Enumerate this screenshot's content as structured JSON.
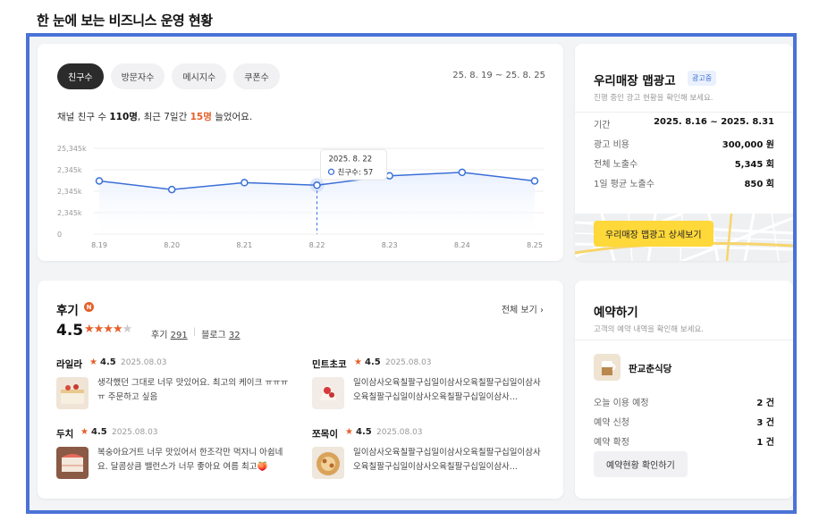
{
  "page_title": "한 눈에 보는 비즈니스 운영 현황",
  "stats": {
    "tabs": [
      {
        "label": "친구수",
        "active": true
      },
      {
        "label": "방문자수",
        "active": false
      },
      {
        "label": "메시지수",
        "active": false
      },
      {
        "label": "쿠폰수",
        "active": false
      }
    ],
    "date_range": "25. 8. 19 ~ 25. 8. 25",
    "summary": {
      "prefix": "채널 친구 수 ",
      "total": "110명",
      "middle": ", 최근 7일간 ",
      "recent": "15명",
      "suffix": " 늘었어요."
    },
    "tooltip": {
      "date": "2025. 8. 22",
      "label": "친구수: 57"
    }
  },
  "chart_data": {
    "type": "line",
    "x": [
      "8.19",
      "8.20",
      "8.21",
      "8.22",
      "8.23",
      "8.24",
      "8.25"
    ],
    "y_tick_labels": [
      "25,345k",
      "2,345k",
      "2,345k",
      "2,345k",
      "0"
    ],
    "series": [
      {
        "name": "친구수",
        "values": [
          62,
          52,
          60,
          57,
          68,
          72,
          62
        ]
      }
    ],
    "highlight_index": 3,
    "ylim": [
      0,
      100
    ],
    "colors": {
      "line": "#3b6fd8",
      "fill": "#e9f0fd"
    }
  },
  "ad": {
    "title": "우리매장 맵광고",
    "badge": "광고중",
    "subtitle": "진행 중인 광고 현황을 확인해 보세요.",
    "rows": [
      {
        "label": "기간",
        "value": "2025. 8.16 ~ 2025. 8.31"
      },
      {
        "label": "광고 비용",
        "value": "300,000 원"
      },
      {
        "label": "전체 노출수",
        "value": "5,345 회"
      },
      {
        "label": "1일 평균 노출수",
        "value": "850 회"
      }
    ],
    "button": "우리매장 맵광고 상세보기"
  },
  "reviews": {
    "title": "후기",
    "badge": "N",
    "see_all": "전체 보기",
    "rating": "4.5",
    "stars_filled": 4,
    "stars_total": 5,
    "review_label": "후기",
    "review_count": "291",
    "blog_label": "블로그",
    "blog_count": "32",
    "items": [
      {
        "name": "라일라",
        "score": "4.5",
        "date": "2025.08.03",
        "text": "생각했던 그대로 너무 맛있어요. 최고의 케이크 ㅠㅠㅠㅠ 주문하고 싶음"
      },
      {
        "name": "민트초코",
        "score": "4.5",
        "date": "2025.08.03",
        "text": "일이삼사오육칠팔구십일이삼사오육칠팔구십일이삼사오육칠팔구십일이삼사오육칠팔구십일이삼사..."
      },
      {
        "name": "두치",
        "score": "4.5",
        "date": "2025.08.03",
        "text": "복숭아요거트 너무 맛있어서 한조각만 먹자니 아쉽네요. 달콤상큼 밸런스가 너무 좋아요 여름 최고🍑"
      },
      {
        "name": "쪼목이",
        "score": "4.5",
        "date": "2025.08.03",
        "text": "일이삼사오육칠팔구십일이삼사오육칠팔구십일이삼사오육칠팔구십일이삼사오육칠팔구십일이삼사..."
      }
    ]
  },
  "reservation": {
    "title": "예약하기",
    "subtitle": "고객의 예약 내역을 확인해 보세요.",
    "shop_name": "판교춘식당",
    "rows": [
      {
        "label": "오늘 이용 예정",
        "value": "2 건"
      },
      {
        "label": "예약 신청",
        "value": "3 건"
      },
      {
        "label": "예약 확정",
        "value": "1 건"
      }
    ],
    "button": "예약현황 확인하기"
  }
}
